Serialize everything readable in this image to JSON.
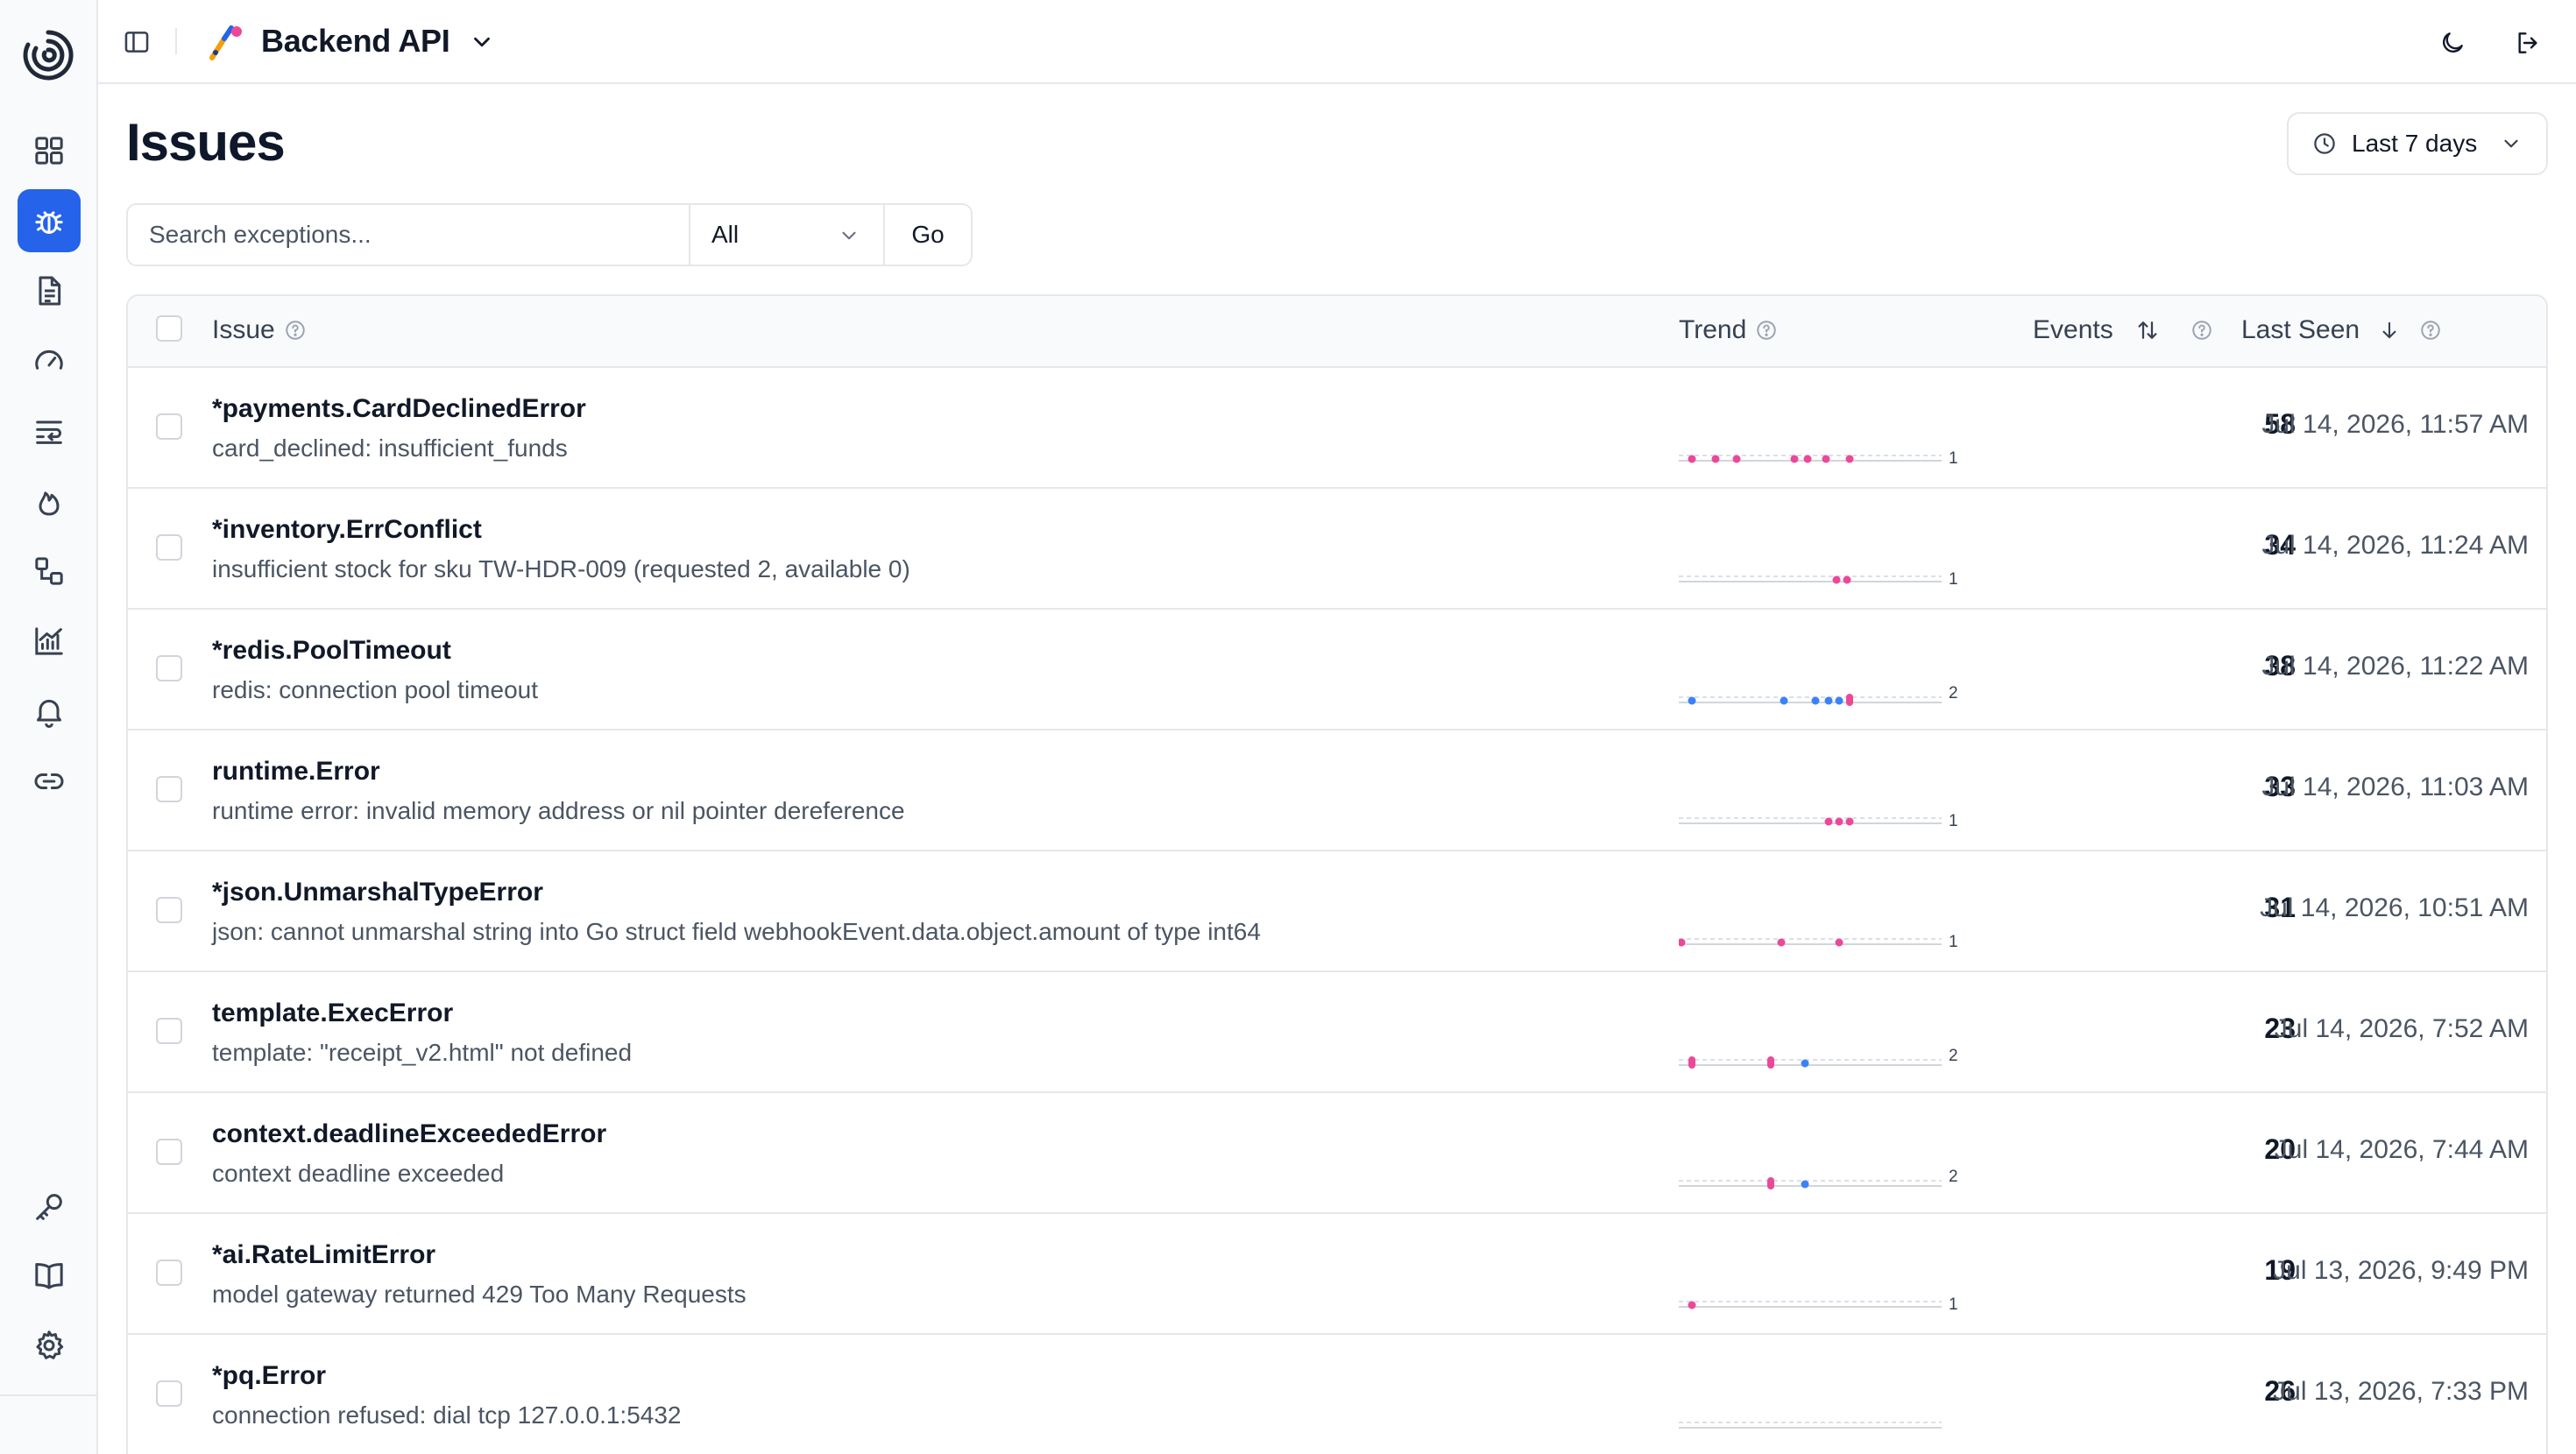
{
  "header": {
    "project_name": "Backend API"
  },
  "sidebar": {
    "items": [
      {
        "icon": "dashboard-icon"
      },
      {
        "icon": "bug-icon",
        "active": true
      },
      {
        "icon": "document-icon"
      },
      {
        "icon": "gauge-icon"
      },
      {
        "icon": "list-wrap-icon"
      },
      {
        "icon": "flame-icon"
      },
      {
        "icon": "workflow-icon"
      },
      {
        "icon": "chart-icon"
      },
      {
        "icon": "bell-icon"
      },
      {
        "icon": "link-icon"
      },
      {
        "icon": "key-icon"
      },
      {
        "icon": "book-icon"
      },
      {
        "icon": "gear-icon"
      }
    ]
  },
  "page": {
    "title": "Issues",
    "time_range": "Last 7 days"
  },
  "search": {
    "placeholder": "Search exceptions...",
    "filter_value": "All",
    "go_label": "Go"
  },
  "table": {
    "columns": {
      "issue": "Issue",
      "trend": "Trend",
      "events": "Events",
      "last_seen": "Last Seen"
    },
    "rows": [
      {
        "title": "*payments.CardDeclinedError",
        "message": "card_declined: insufficient_funds",
        "events": "58",
        "last_seen": "Jul 14, 2026, 11:57 AM",
        "trend_max": "1",
        "trend_points": [
          {
            "x": 0.05,
            "v": 1,
            "c": "#ec4899"
          },
          {
            "x": 0.14,
            "v": 1,
            "c": "#ec4899"
          },
          {
            "x": 0.22,
            "v": 1,
            "c": "#ec4899"
          },
          {
            "x": 0.44,
            "v": 1,
            "c": "#ec4899"
          },
          {
            "x": 0.49,
            "v": 1,
            "c": "#ec4899"
          },
          {
            "x": 0.56,
            "v": 1,
            "c": "#ec4899"
          },
          {
            "x": 0.65,
            "v": 1,
            "c": "#ec4899"
          }
        ]
      },
      {
        "title": "*inventory.ErrConflict",
        "message": "insufficient stock for sku TW-HDR-009 (requested 2, available 0)",
        "events": "34",
        "last_seen": "Jul 14, 2026, 11:24 AM",
        "trend_max": "1",
        "trend_points": [
          {
            "x": 0.6,
            "v": 1,
            "c": "#ec4899"
          },
          {
            "x": 0.64,
            "v": 1,
            "c": "#ec4899"
          }
        ]
      },
      {
        "title": "*redis.PoolTimeout",
        "message": "redis: connection pool timeout",
        "events": "38",
        "last_seen": "Jul 14, 2026, 11:22 AM",
        "trend_max": "2",
        "trend_points": [
          {
            "x": 0.05,
            "v": 1,
            "c": "#3b82f6"
          },
          {
            "x": 0.4,
            "v": 1,
            "c": "#3b82f6"
          },
          {
            "x": 0.52,
            "v": 1,
            "c": "#3b82f6"
          },
          {
            "x": 0.57,
            "v": 1,
            "c": "#3b82f6"
          },
          {
            "x": 0.61,
            "v": 1,
            "c": "#3b82f6"
          },
          {
            "x": 0.65,
            "v": 2,
            "c": "#ec4899"
          }
        ]
      },
      {
        "title": "runtime.Error",
        "message": "runtime error: invalid memory address or nil pointer dereference",
        "events": "33",
        "last_seen": "Jul 14, 2026, 11:03 AM",
        "trend_max": "1",
        "trend_points": [
          {
            "x": 0.57,
            "v": 1,
            "c": "#ec4899"
          },
          {
            "x": 0.61,
            "v": 1,
            "c": "#ec4899"
          },
          {
            "x": 0.65,
            "v": 1,
            "c": "#ec4899"
          }
        ]
      },
      {
        "title": "*json.UnmarshalTypeError",
        "message": "json: cannot unmarshal string into Go struct field webhookEvent.data.object.amount of type int64",
        "events": "31",
        "last_seen": "Jul 14, 2026, 10:51 AM",
        "trend_max": "1",
        "trend_points": [
          {
            "x": 0.01,
            "v": 1,
            "c": "#ec4899"
          },
          {
            "x": 0.39,
            "v": 1,
            "c": "#ec4899"
          },
          {
            "x": 0.61,
            "v": 1,
            "c": "#ec4899"
          }
        ]
      },
      {
        "title": "template.ExecError",
        "message": "template: \"receipt_v2.html\" not defined",
        "events": "23",
        "last_seen": "Jul 14, 2026, 7:52 AM",
        "trend_max": "2",
        "trend_points": [
          {
            "x": 0.05,
            "v": 2,
            "c": "#ec4899"
          },
          {
            "x": 0.35,
            "v": 2,
            "c": "#ec4899"
          },
          {
            "x": 0.48,
            "v": 1,
            "c": "#3b82f6"
          }
        ]
      },
      {
        "title": "context.deadlineExceededError",
        "message": "context deadline exceeded",
        "events": "20",
        "last_seen": "Jul 14, 2026, 7:44 AM",
        "trend_max": "2",
        "trend_points": [
          {
            "x": 0.35,
            "v": 2,
            "c": "#ec4899"
          },
          {
            "x": 0.48,
            "v": 1,
            "c": "#3b82f6"
          }
        ]
      },
      {
        "title": "*ai.RateLimitError",
        "message": "model gateway returned 429 Too Many Requests",
        "events": "19",
        "last_seen": "Jul 13, 2026, 9:49 PM",
        "trend_max": "1",
        "trend_points": [
          {
            "x": 0.05,
            "v": 1,
            "c": "#ec4899"
          }
        ]
      },
      {
        "title": "*pq.Error",
        "message": "connection refused: dial tcp 127.0.0.1:5432",
        "events": "26",
        "last_seen": "Jul 13, 2026, 7:33 PM",
        "trend_max": "",
        "trend_points": []
      }
    ]
  },
  "colors": {
    "accent": "#2563eb",
    "trend_pink": "#ec4899",
    "trend_blue": "#3b82f6"
  }
}
